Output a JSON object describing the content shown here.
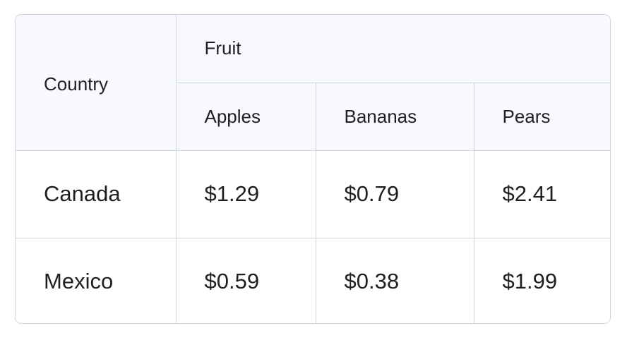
{
  "table": {
    "header": {
      "country": "Country",
      "group": "Fruit",
      "columns": [
        "Apples",
        "Bananas",
        "Pears"
      ]
    },
    "rows": [
      {
        "country": "Canada",
        "values": [
          "$1.29",
          "$0.79",
          "$2.41"
        ]
      },
      {
        "country": "Mexico",
        "values": [
          "$0.59",
          "$0.38",
          "$1.99"
        ]
      }
    ]
  },
  "colors": {
    "border": "#cfd6de",
    "header_background": "#f8f9fe",
    "text": "#1f1f1f"
  }
}
